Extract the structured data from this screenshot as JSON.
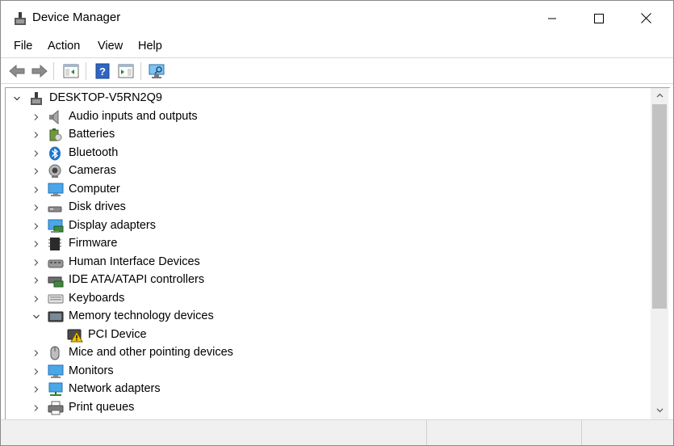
{
  "window": {
    "title": "Device Manager"
  },
  "menu": {
    "file": "File",
    "action": "Action",
    "view": "View",
    "help": "Help"
  },
  "tree": {
    "root": "DESKTOP-V5RN2Q9",
    "items": [
      {
        "label": "Audio inputs and outputs",
        "icon": "speaker-icon"
      },
      {
        "label": "Batteries",
        "icon": "battery-icon"
      },
      {
        "label": "Bluetooth",
        "icon": "bluetooth-icon"
      },
      {
        "label": "Cameras",
        "icon": "camera-icon"
      },
      {
        "label": "Computer",
        "icon": "computer-icon"
      },
      {
        "label": "Disk drives",
        "icon": "disk-drive-icon"
      },
      {
        "label": "Display adapters",
        "icon": "display-adapter-icon"
      },
      {
        "label": "Firmware",
        "icon": "firmware-icon"
      },
      {
        "label": "Human Interface Devices",
        "icon": "hid-icon"
      },
      {
        "label": "IDE ATA/ATAPI controllers",
        "icon": "ide-controller-icon"
      },
      {
        "label": "Keyboards",
        "icon": "keyboard-icon"
      },
      {
        "label": "Memory technology devices",
        "icon": "memory-device-icon",
        "expanded": true
      },
      {
        "label": "PCI Device",
        "icon": "warning-device-icon",
        "child": true
      },
      {
        "label": "Mice and other pointing devices",
        "icon": "mouse-icon"
      },
      {
        "label": "Monitors",
        "icon": "monitor-icon"
      },
      {
        "label": "Network adapters",
        "icon": "network-adapter-icon"
      },
      {
        "label": "Print queues",
        "icon": "printer-icon"
      }
    ]
  }
}
